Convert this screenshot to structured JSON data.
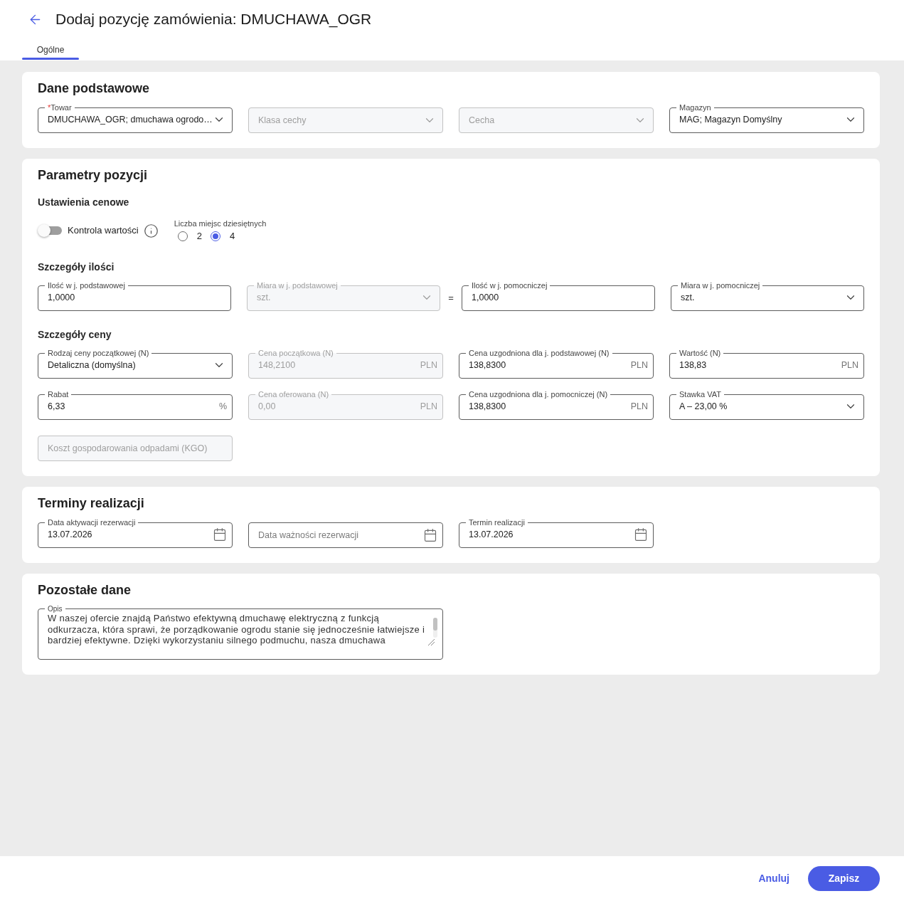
{
  "header": {
    "title": "Dodaj pozycję zamówienia: DMUCHAWA_OGR",
    "tabs": [
      {
        "label": "Ogólne",
        "selected": true
      }
    ]
  },
  "sections": [
    {
      "title": "Dane podstawowe",
      "blocks": [
        {
          "kind": "row",
          "items": [
            {
              "kind": "select",
              "label": "Towar",
              "required_mark": "*",
              "value": "DMUCHAWA_OGR; dmuchawa ogrodo…",
              "disabled": false
            },
            {
              "kind": "select",
              "placeholder": "Klasa cechy",
              "disabled": true
            },
            {
              "kind": "select",
              "placeholder": "Cecha",
              "disabled": true
            },
            {
              "kind": "select",
              "label": "Magazyn",
              "value": "MAG; Magazyn Domyślny",
              "disabled": false
            }
          ]
        }
      ]
    },
    {
      "title": "Parametry pozycji",
      "blocks": [
        {
          "kind": "subheading",
          "text": "Ustawienia cenowe"
        },
        {
          "kind": "settings",
          "toggle": {
            "label": "Kontrola wartości",
            "on": false
          },
          "radio_group": {
            "label": "Liczba miejsc dziesiętnych",
            "options": [
              {
                "label": "2",
                "selected": false
              },
              {
                "label": "4",
                "selected": true
              }
            ]
          }
        },
        {
          "kind": "subheading",
          "text": "Szczegóły ilości"
        },
        {
          "kind": "row",
          "items": [
            {
              "kind": "text",
              "label": "Ilość w j. podstawowej",
              "value": "1,0000",
              "disabled": false
            },
            {
              "kind": "select",
              "label": "Miara w j. podstawowej",
              "value": "szt.",
              "disabled": true
            },
            {
              "kind": "separator",
              "text": "="
            },
            {
              "kind": "text",
              "label": "Ilość w j. pomocniczej",
              "value": "1,0000",
              "disabled": false
            },
            {
              "kind": "select",
              "label": "Miara w j. pomocniczej",
              "value": "szt.",
              "disabled": false
            }
          ]
        },
        {
          "kind": "subheading",
          "text": "Szczegóły ceny"
        },
        {
          "kind": "row",
          "items": [
            {
              "kind": "select",
              "label": "Rodzaj ceny początkowej (N)",
              "value": "Detaliczna (domyślna)",
              "disabled": false
            },
            {
              "kind": "text",
              "label": "Cena początkowa (N)",
              "value": "148,2100",
              "suffix": "PLN",
              "disabled": true
            },
            {
              "kind": "text",
              "label": "Cena uzgodniona dla j. podstawowej (N)",
              "value": "138,8300",
              "suffix": "PLN",
              "disabled": false
            },
            {
              "kind": "text",
              "label": "Wartość (N)",
              "value": "138,83",
              "suffix": "PLN",
              "disabled": false
            }
          ]
        },
        {
          "kind": "row",
          "items": [
            {
              "kind": "text",
              "label": "Rabat",
              "value": "6,33",
              "suffix": "%",
              "disabled": false
            },
            {
              "kind": "text",
              "label": "Cena oferowana (N)",
              "value": "0,00",
              "suffix": "PLN",
              "disabled": true
            },
            {
              "kind": "text",
              "label": "Cena uzgodniona dla j. pomocniczej (N)",
              "value": "138,8300",
              "suffix": "PLN",
              "disabled": false
            },
            {
              "kind": "select",
              "label": "Stawka VAT",
              "value": "A – 23,00 %",
              "disabled": false
            }
          ]
        },
        {
          "kind": "row",
          "items": [
            {
              "kind": "text",
              "placeholder": "Koszt gospodarowania odpadami (KGO)",
              "disabled": true
            }
          ]
        }
      ]
    },
    {
      "title": "Terminy realizacji",
      "blocks": [
        {
          "kind": "row",
          "items": [
            {
              "kind": "date",
              "label": "Data aktywacji rezerwacji",
              "value": "13.07.2026",
              "disabled": false
            },
            {
              "kind": "date",
              "placeholder": "Data ważności rezerwacji",
              "disabled": false
            },
            {
              "kind": "date",
              "label": "Termin realizacji",
              "value": "13.07.2026",
              "disabled": false
            }
          ]
        }
      ]
    },
    {
      "title": "Pozostałe dane",
      "blocks": [
        {
          "kind": "row",
          "items": [
            {
              "kind": "textarea",
              "label": "Opis",
              "value": "W naszej ofercie znajdą Państwo efektywną dmuchawę elektryczną z funkcją odkurzacza, która sprawi, że porządkowanie ogrodu stanie się jednocześnie łatwiejsze i bardziej efektywne. Dzięki wykorzystaniu silnego podmuchu, nasza dmuchawa",
              "disabled": false
            }
          ]
        }
      ]
    }
  ],
  "footer": {
    "buttons": [
      {
        "label": "Anuluj",
        "kind": "text"
      },
      {
        "label": "Zapisz",
        "kind": "primary"
      }
    ]
  }
}
